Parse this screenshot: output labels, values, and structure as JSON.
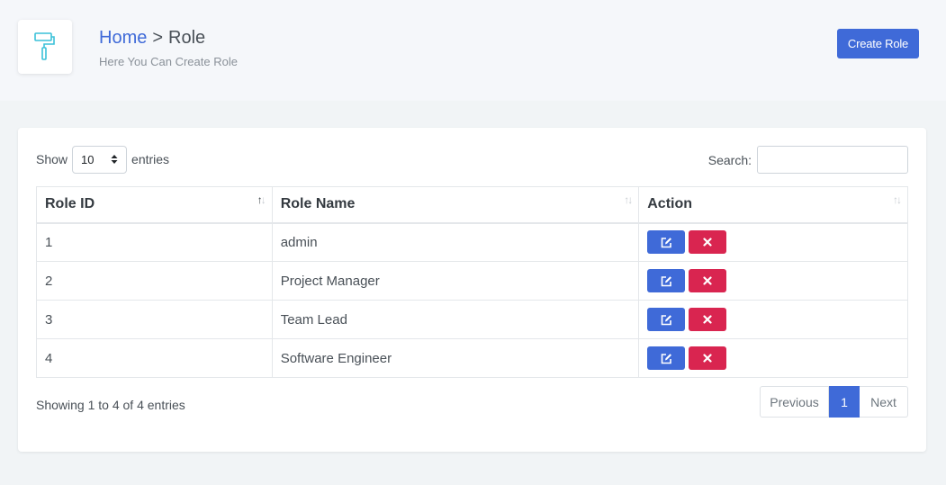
{
  "header": {
    "breadcrumb_home": "Home",
    "breadcrumb_sep": ">",
    "breadcrumb_current": "Role",
    "subtitle": "Here You Can Create Role",
    "icon": "paint-roller-icon",
    "create_button": "Create Role"
  },
  "controls": {
    "show_label": "Show",
    "page_size": "10",
    "entries_label": "entries",
    "search_label": "Search:",
    "search_value": ""
  },
  "table": {
    "columns": [
      "Role ID",
      "Role Name",
      "Action"
    ],
    "rows": [
      {
        "id": "1",
        "name": "admin"
      },
      {
        "id": "2",
        "name": "Project Manager"
      },
      {
        "id": "3",
        "name": "Team Lead"
      },
      {
        "id": "4",
        "name": "Software Engineer"
      }
    ]
  },
  "footer": {
    "info": "Showing 1 to 4 of 4 entries",
    "prev": "Previous",
    "page": "1",
    "next": "Next"
  },
  "colors": {
    "primary": "#3f6ad8",
    "danger": "#d92550",
    "icon": "#3ac1d9"
  }
}
